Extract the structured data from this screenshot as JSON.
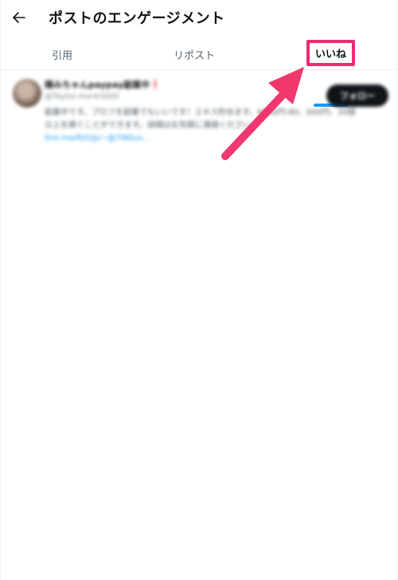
{
  "header": {
    "title": "ポストのエンゲージメント",
    "back_icon": "arrow-left-icon"
  },
  "tabs": [
    {
      "label": "引用",
      "active": false
    },
    {
      "label": "リポスト",
      "active": false
    },
    {
      "label": "いいね",
      "active": true
    }
  ],
  "user": {
    "name": "陽みちゃんpaypay副業中❗",
    "handle": "@Taylor.mer43000",
    "bio": "副業中です。プロフを副業でもいいです！エキス貯めます。6000円-80、000円、20個以上を稼ぐことができます。詳細はお気軽に連絡ください",
    "link": "line.me/R/ti/p/~@796luv...",
    "follow_label": "フォロー"
  },
  "colors": {
    "highlight_box": "#ef2a73",
    "arrow": "#f0376e",
    "tab_underline": "#1d9bf0"
  }
}
